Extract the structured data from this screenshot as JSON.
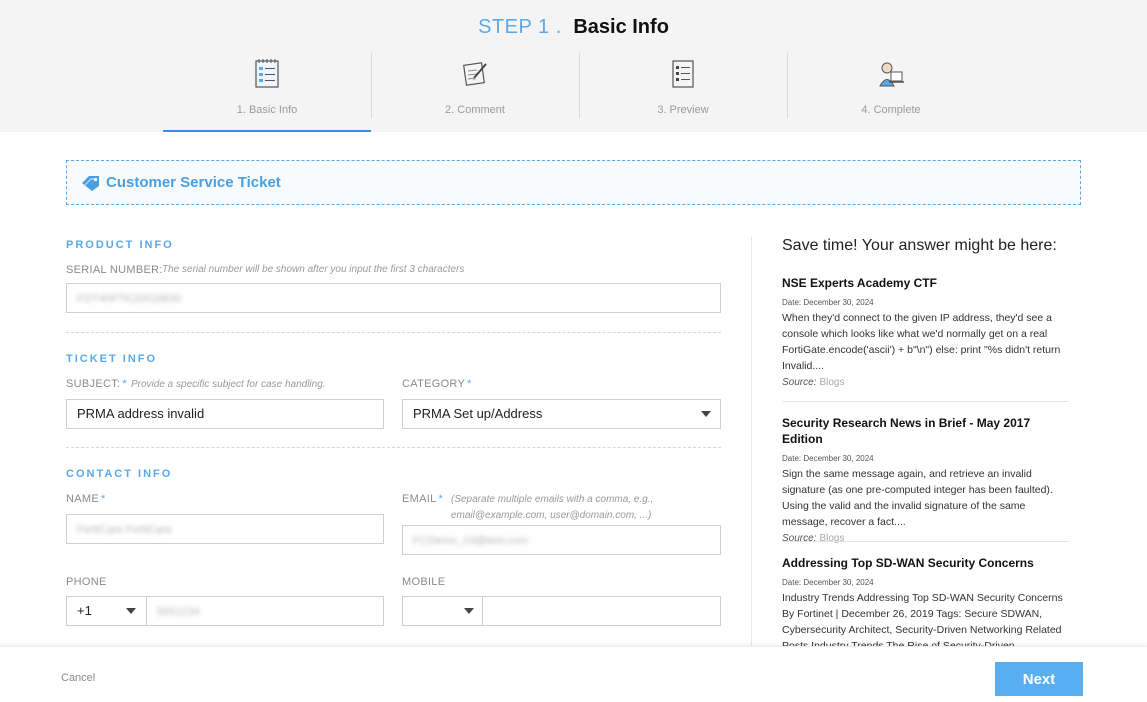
{
  "header": {
    "step_number": "STEP 1 .",
    "step_name": "Basic Info",
    "steps": [
      {
        "label": "1. Basic Info",
        "icon": "checklist-icon",
        "active": true
      },
      {
        "label": "2. Comment",
        "icon": "pen-note-icon",
        "active": false
      },
      {
        "label": "3. Preview",
        "icon": "document-list-icon",
        "active": false
      },
      {
        "label": "4. Complete",
        "icon": "person-laptop-icon",
        "active": false
      }
    ]
  },
  "banner": {
    "title": "Customer Service Ticket",
    "icon": "tag-icon"
  },
  "product_info": {
    "section": "PRODUCT INFO",
    "serial_label": "SERIAL NUMBER:",
    "serial_hint": "The serial number will be shown after you input the first 3 characters",
    "serial_value": "FGT40FTK20016830"
  },
  "ticket_info": {
    "section": "TICKET INFO",
    "subject_label": "SUBJECT:",
    "subject_hint": "Provide a specific subject for case handling.",
    "subject_value": "PRMA address invalid",
    "category_label": "CATEGORY",
    "category_value": "PRMA Set up/Address"
  },
  "contact_info": {
    "section": "CONTACT INFO",
    "name_label": "NAME",
    "name_value": "FortiCare FortiCare",
    "email_label": "EMAIL",
    "email_hint": "(Separate multiple emails with a comma, e.g., email@example.com, user@domain.com, ...)",
    "email_value": "FCDemo_03@test.com",
    "phone_label": "PHONE",
    "phone_code": "+1",
    "phone_value": "5551234",
    "mobile_label": "MOBILE",
    "mobile_code": "",
    "mobile_value": ""
  },
  "help": {
    "title": "Save time! Your answer might be here:",
    "source_label": "Source:",
    "articles": [
      {
        "title": "NSE Experts Academy CTF",
        "date": "Date: December 30, 2024",
        "body": "When they'd connect to the given IP address, they'd see a console which looks like what we'd normally get on a real FortiGate.encode('ascii') + b\"\\n\") else: print \"%s didn't return Invalid....",
        "source": "Blogs"
      },
      {
        "title": "Security Research News in Brief - May 2017 Edition",
        "date": "Date: December 30, 2024",
        "body": "Sign the same message again, and retrieve an invalid signature (as one pre-computed integer has been faulted). Using the valid and the invalid signature of the same message, recover a fact....",
        "source": "Blogs"
      },
      {
        "title": "Addressing Top SD-WAN Security Concerns",
        "date": "Date: December 30, 2024",
        "body": "Industry Trends Addressing Top SD-WAN Security Concerns By Fortinet | December 26, 2019 Tags: Secure SDWAN, Cybersecurity Architect, Security-Driven Networking Related Posts Industry Trends The Rise of Security-Driven",
        "source": ""
      }
    ]
  },
  "footer": {
    "cancel": "Cancel",
    "next": "Next"
  },
  "colors": {
    "accent": "#5aa9e6",
    "button": "#58aef0",
    "header_bg": "#f4f4f4"
  }
}
